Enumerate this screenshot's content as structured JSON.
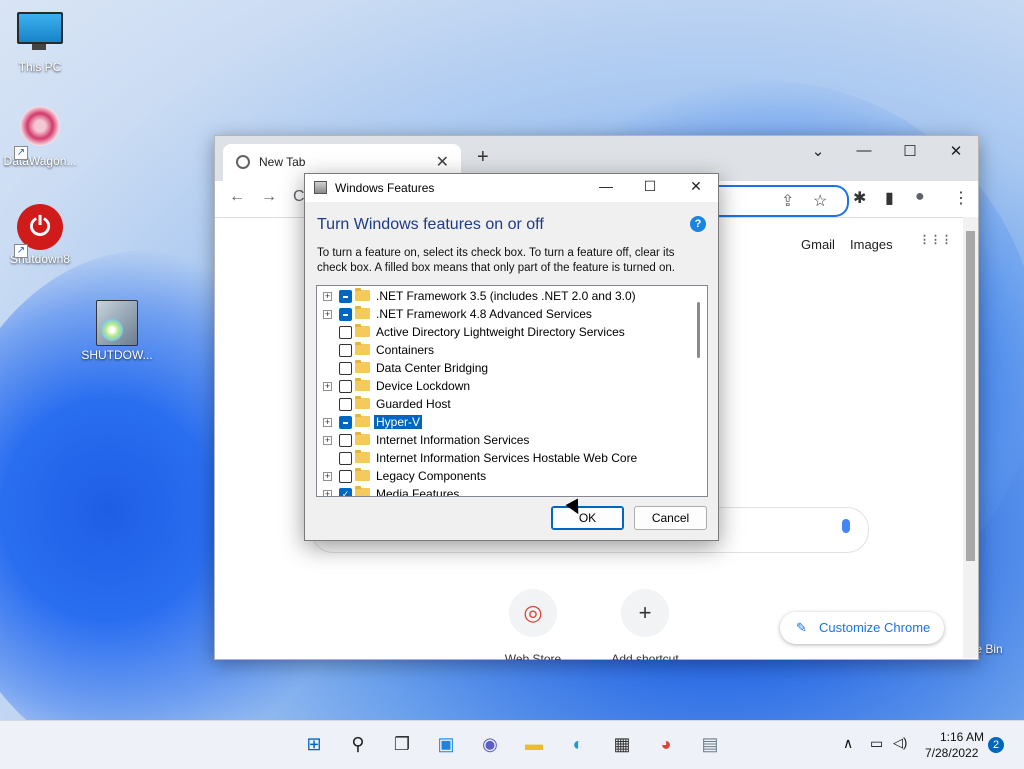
{
  "desktop": {
    "icons": [
      {
        "label": "This PC"
      },
      {
        "label": "DataWagon..."
      },
      {
        "label": "Shutdown8"
      },
      {
        "label": "SHUTDOW..."
      },
      {
        "label": "e Bin"
      }
    ]
  },
  "chrome": {
    "tab_title": "New Tab",
    "tab_close": "✕",
    "new_tab": "+",
    "win_down": "⌄",
    "win_min": "—",
    "win_max": "☐",
    "win_close": "✕",
    "back": "←",
    "forward": "→",
    "reload": "C",
    "share": "⇪",
    "star": "☆",
    "extensions": "✱",
    "sidepanel": "▮",
    "profile": "●",
    "menu": "⋮",
    "gmail": "Gmail",
    "images": "Images",
    "apps": "⋮⋮⋮",
    "shortcuts": [
      {
        "label": "Web Store",
        "glyph": "◎"
      },
      {
        "label": "Add shortcut",
        "glyph": "+"
      }
    ],
    "customize": "Customize Chrome",
    "customize_icon": "✎"
  },
  "dialog": {
    "title": "Windows Features",
    "min": "—",
    "max": "☐",
    "close": "✕",
    "heading": "Turn Windows features on or off",
    "help": "?",
    "description": "To turn a feature on, select its check box. To turn a feature off, clear its check box. A filled box means that only part of the feature is turned on.",
    "features": [
      {
        "label": ".NET Framework 3.5 (includes .NET 2.0 and 3.0)",
        "expand": "+",
        "state": "partial"
      },
      {
        "label": ".NET Framework 4.8 Advanced Services",
        "expand": "+",
        "state": "partial"
      },
      {
        "label": "Active Directory Lightweight Directory Services",
        "expand": "",
        "state": "off"
      },
      {
        "label": "Containers",
        "expand": "",
        "state": "off"
      },
      {
        "label": "Data Center Bridging",
        "expand": "",
        "state": "off"
      },
      {
        "label": "Device Lockdown",
        "expand": "+",
        "state": "off"
      },
      {
        "label": "Guarded Host",
        "expand": "",
        "state": "off"
      },
      {
        "label": "Hyper-V",
        "expand": "+",
        "state": "partial",
        "selected": true
      },
      {
        "label": "Internet Information Services",
        "expand": "+",
        "state": "off"
      },
      {
        "label": "Internet Information Services Hostable Web Core",
        "expand": "",
        "state": "off"
      },
      {
        "label": "Legacy Components",
        "expand": "+",
        "state": "off"
      },
      {
        "label": "Media Features",
        "expand": "+",
        "state": "checked"
      }
    ],
    "ok": "OK",
    "cancel": "Cancel"
  },
  "taskbar": {
    "apps": [
      {
        "name": "start-button",
        "glyph": "⊞",
        "color": "#0067c0"
      },
      {
        "name": "search-button",
        "glyph": "⚲",
        "color": "#222222"
      },
      {
        "name": "task-view-button",
        "glyph": "❐",
        "color": "#333333"
      },
      {
        "name": "widgets-button",
        "glyph": "▣",
        "color": "#1c84e0"
      },
      {
        "name": "teams-chat-button",
        "glyph": "◉",
        "color": "#5b5fc7"
      },
      {
        "name": "file-explorer-button",
        "glyph": "▬",
        "color": "#f2b92e"
      },
      {
        "name": "edge-button",
        "glyph": "◐",
        "color": "#1a9ad6"
      },
      {
        "name": "store-button",
        "glyph": "▦",
        "color": "#333333"
      },
      {
        "name": "chrome-button",
        "glyph": "◕",
        "color": "#db4437"
      },
      {
        "name": "installer-button",
        "glyph": "▤",
        "color": "#6a7d8e"
      }
    ],
    "tray_chevron": "∧",
    "tray_network": "▭",
    "tray_volume": "◁)",
    "time": "1:16 AM",
    "date": "7/28/2022",
    "notifications": "2"
  }
}
